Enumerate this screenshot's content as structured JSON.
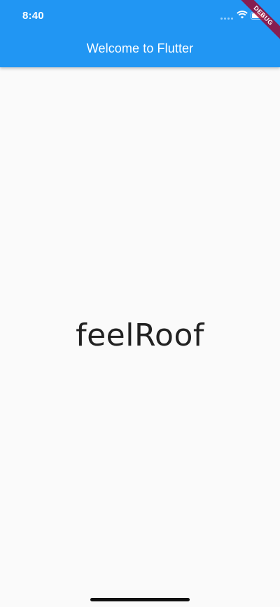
{
  "status_bar": {
    "time": "8:40"
  },
  "app_bar": {
    "title": "Welcome to Flutter",
    "background_color": "#2196f3"
  },
  "debug_banner": {
    "label": "DEBUG"
  },
  "body": {
    "word": "feelRoof"
  },
  "icons": [
    "signal-dots-icon",
    "wifi-icon",
    "battery-icon"
  ]
}
